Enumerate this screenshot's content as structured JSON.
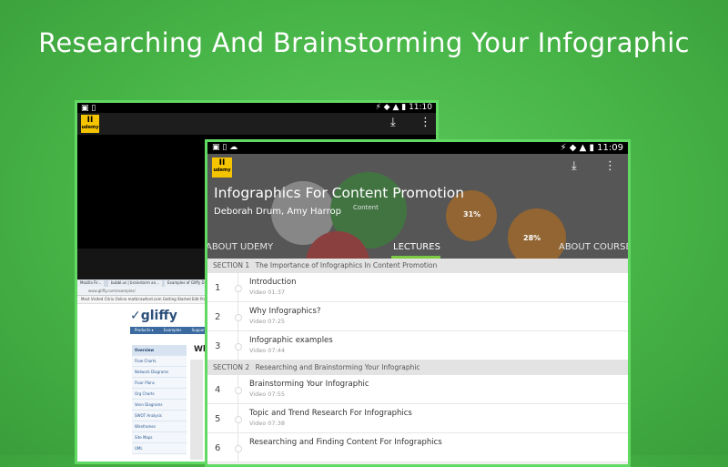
{
  "headline": "Researching And Brainstorming Your Infographic",
  "colors": {
    "background": "#47b447",
    "accent": "#7ac943",
    "udemy_yellow": "#f5c400"
  },
  "back_device": {
    "status_time": "11:10",
    "logo_text": "udemy",
    "browser": {
      "tabs": [
        "Mozilla Fir...",
        "bubbl.us | brainstorm an...",
        "Examples of Gliffy Diagra..."
      ],
      "url": "www.gliffy.com/examples/",
      "bookmarks": "Most Visited   Citrix Online   mattcrawford.com   Getting Started   Edit Pro...",
      "site_logo": "gliffy",
      "nav": [
        "Products ▾",
        "Examples",
        "Support"
      ],
      "sidebar": [
        "Overview",
        "Flow Charts",
        "Network Diagrams",
        "Floor Plans",
        "Org Charts",
        "Venn Diagrams",
        "SWOT Analysis",
        "Wireframes",
        "Site Maps",
        "UML"
      ],
      "heading_fragment": "Wh"
    }
  },
  "front_device": {
    "status_time": "11:09",
    "logo_text": "udemy",
    "hero_labels": [
      "Content",
      "31%",
      "28%"
    ],
    "course_title": "Infographics For Content Promotion",
    "authors": "Deborah Drum, Amy Harrop",
    "tabs": {
      "left": "ABOUT UDEMY",
      "center": "LECTURES",
      "right": "ABOUT COURSE"
    },
    "sections": [
      {
        "label": "SECTION 1",
        "title": "The Importance of Infographics In Content Promotion",
        "lectures": [
          {
            "num": "1",
            "title": "Introduction",
            "sub": "Video 01:37"
          },
          {
            "num": "2",
            "title": "Why Infographics?",
            "sub": "Video 07:25"
          },
          {
            "num": "3",
            "title": "Infographic examples",
            "sub": "Video 07:44"
          }
        ]
      },
      {
        "label": "SECTION 2",
        "title": "Researching and Brainstorming Your Infographic",
        "lectures": [
          {
            "num": "4",
            "title": "Brainstorming Your Infographic",
            "sub": "Video 07:55"
          },
          {
            "num": "5",
            "title": "Topic and Trend Research For Infographics",
            "sub": "Video 07:38"
          },
          {
            "num": "6",
            "title": "Researching and Finding Content For Infographics",
            "sub": ""
          }
        ]
      }
    ]
  }
}
